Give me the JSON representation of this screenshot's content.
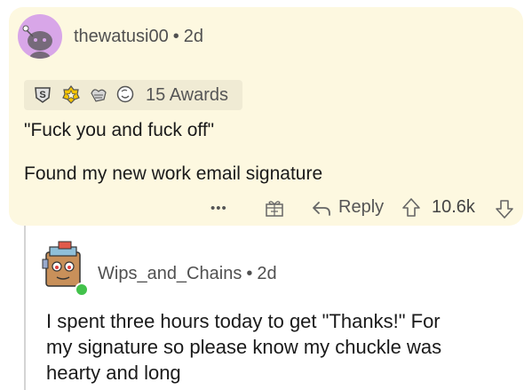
{
  "comment": {
    "username": "thewatusi00",
    "separator": "•",
    "age": "2d",
    "awards_label": "15 Awards",
    "body_lines": [
      "\"Fuck you and fuck off\"",
      "Found my new work email signature"
    ],
    "actions": {
      "more": "•••",
      "reply": "Reply",
      "score": "10.6k"
    },
    "award_icons": [
      "silver-award-icon",
      "gold-award-icon",
      "wholesome-award-icon",
      "helpful-award-icon"
    ],
    "avatar_color": "#d8a6e8",
    "highlight_color": "#fdf8e0"
  },
  "reply": {
    "username": "Wips_and_Chains",
    "separator": "•",
    "age": "2d",
    "body_lines": [
      "I spent three hours today to get \"Thanks!\" For",
      "my signature so please know my chuckle was",
      "hearty and long"
    ],
    "online_color": "#42c24b"
  }
}
